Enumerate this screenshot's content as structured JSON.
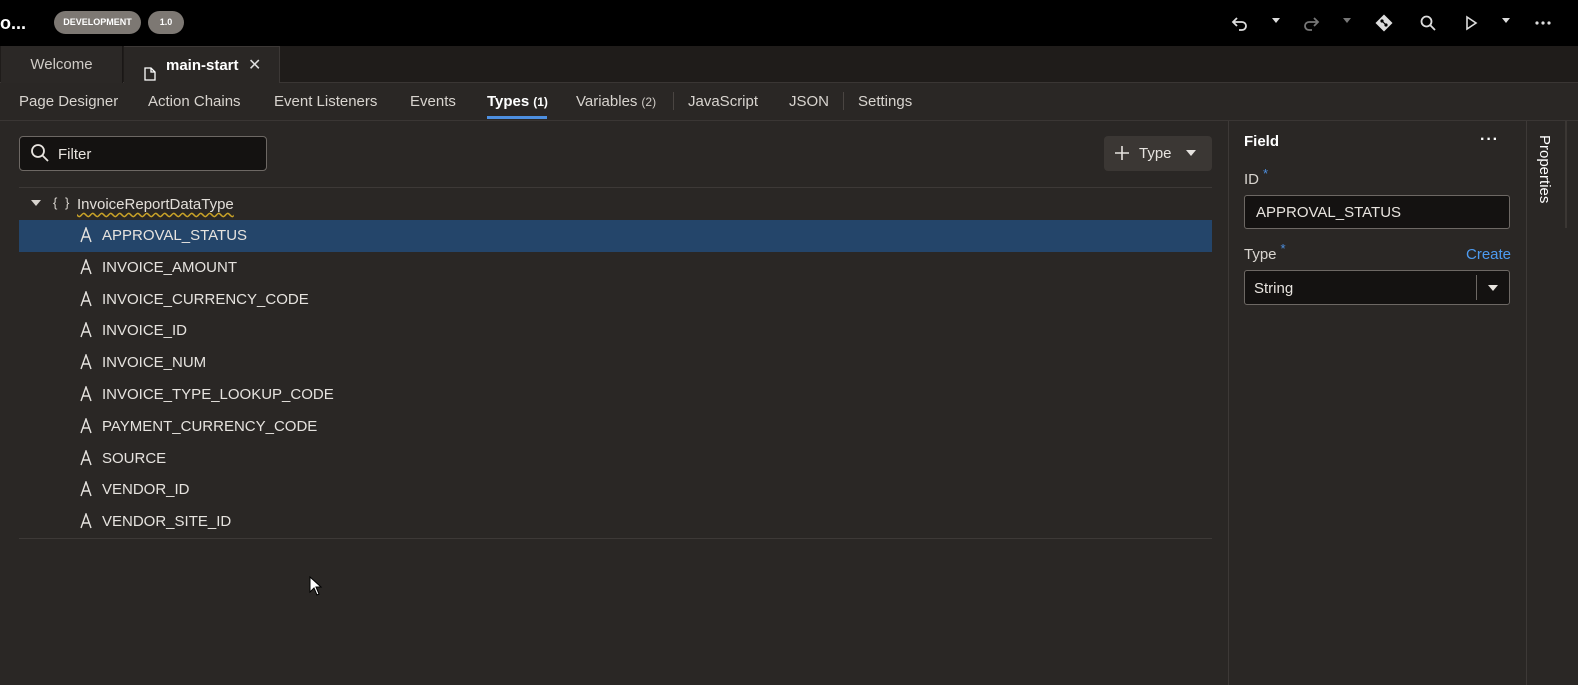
{
  "header": {
    "app_title": "o...",
    "badge_env": "DEVELOPMENT",
    "badge_version": "1.0",
    "icons": [
      "undo-icon",
      "undo-menu-caret",
      "redo-icon",
      "redo-menu-caret",
      "git-icon",
      "search-icon",
      "run-icon",
      "run-menu-caret",
      "more-icon"
    ]
  },
  "file_tabs": [
    {
      "label": "Welcome"
    },
    {
      "label": "main-start",
      "close": "✕"
    }
  ],
  "editor_tabs": [
    {
      "label": "Page Designer"
    },
    {
      "label": "Action Chains"
    },
    {
      "label": "Event Listeners"
    },
    {
      "label": "Events"
    },
    {
      "label": "Types",
      "count": "(1)",
      "active": true
    },
    {
      "label": "Variables",
      "count": "(2)"
    },
    {
      "label": "JavaScript"
    },
    {
      "label": "JSON"
    },
    {
      "label": "Settings"
    }
  ],
  "toolbar": {
    "filter_placeholder": "Filter",
    "add_type_label": "Type"
  },
  "tree": {
    "braces": "{ }",
    "type_name": "InvoiceReportDataType",
    "fields": [
      "APPROVAL_STATUS",
      "INVOICE_AMOUNT",
      "INVOICE_CURRENCY_CODE",
      "INVOICE_ID",
      "INVOICE_NUM",
      "INVOICE_TYPE_LOOKUP_CODE",
      "PAYMENT_CURRENCY_CODE",
      "SOURCE",
      "VENDOR_ID",
      "VENDOR_SITE_ID"
    ],
    "selected_index": 0
  },
  "properties": {
    "title": "Field",
    "more": "···",
    "id_label": "ID",
    "required_mark": "*",
    "id_value": "APPROVAL_STATUS",
    "type_label": "Type",
    "create_link": "Create",
    "type_value": "String",
    "rail_tab": "Properties"
  },
  "colors": {
    "accent": "#4d8fe0",
    "selected_row": "#24456a",
    "background": "#2a2725"
  }
}
